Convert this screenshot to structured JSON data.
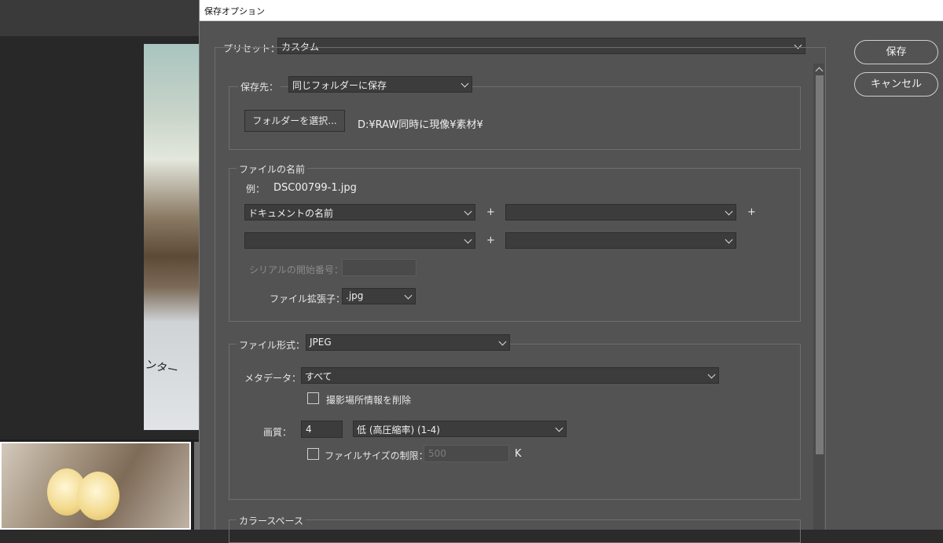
{
  "background": {
    "photo_scribble": "ンター",
    "thumbnail_count": 1
  },
  "dialog": {
    "title": "保存オプション",
    "preset": {
      "label": "プリセット：",
      "value": "カスタム"
    },
    "buttons": {
      "save": "保存",
      "cancel": "キャンセル"
    },
    "save_to": {
      "label": "保存先：",
      "value": "同じフォルダーに保存",
      "choose_folder_button": "フォルダーを選択...",
      "path": "D:¥RAW同時に現像¥素材¥"
    },
    "file_name": {
      "legend": "ファイルの名前",
      "example_label": "例：",
      "example_value": "DSC00799-1.jpg",
      "field1": "ドキュメントの名前",
      "field2": "",
      "field3": "",
      "field4": "",
      "plus": "+",
      "serial_label": "シリアルの開始番号：",
      "serial_value": "",
      "ext_label": "ファイル拡張子：",
      "ext_value": ".jpg"
    },
    "file_format": {
      "label": "ファイル形式：",
      "value": "JPEG",
      "metadata_label": "メタデータ：",
      "metadata_value": "すべて",
      "remove_location_label": "撮影場所情報を削除",
      "remove_location_checked": false,
      "quality_label": "画質：",
      "quality_value": "4",
      "quality_preset": "低 (高圧縮率) (1-4)",
      "limit_size_label": "ファイルサイズの制限：",
      "limit_size_checked": false,
      "limit_size_value": "500",
      "limit_size_unit": "K"
    },
    "color_space": {
      "legend": "カラースペース"
    }
  }
}
